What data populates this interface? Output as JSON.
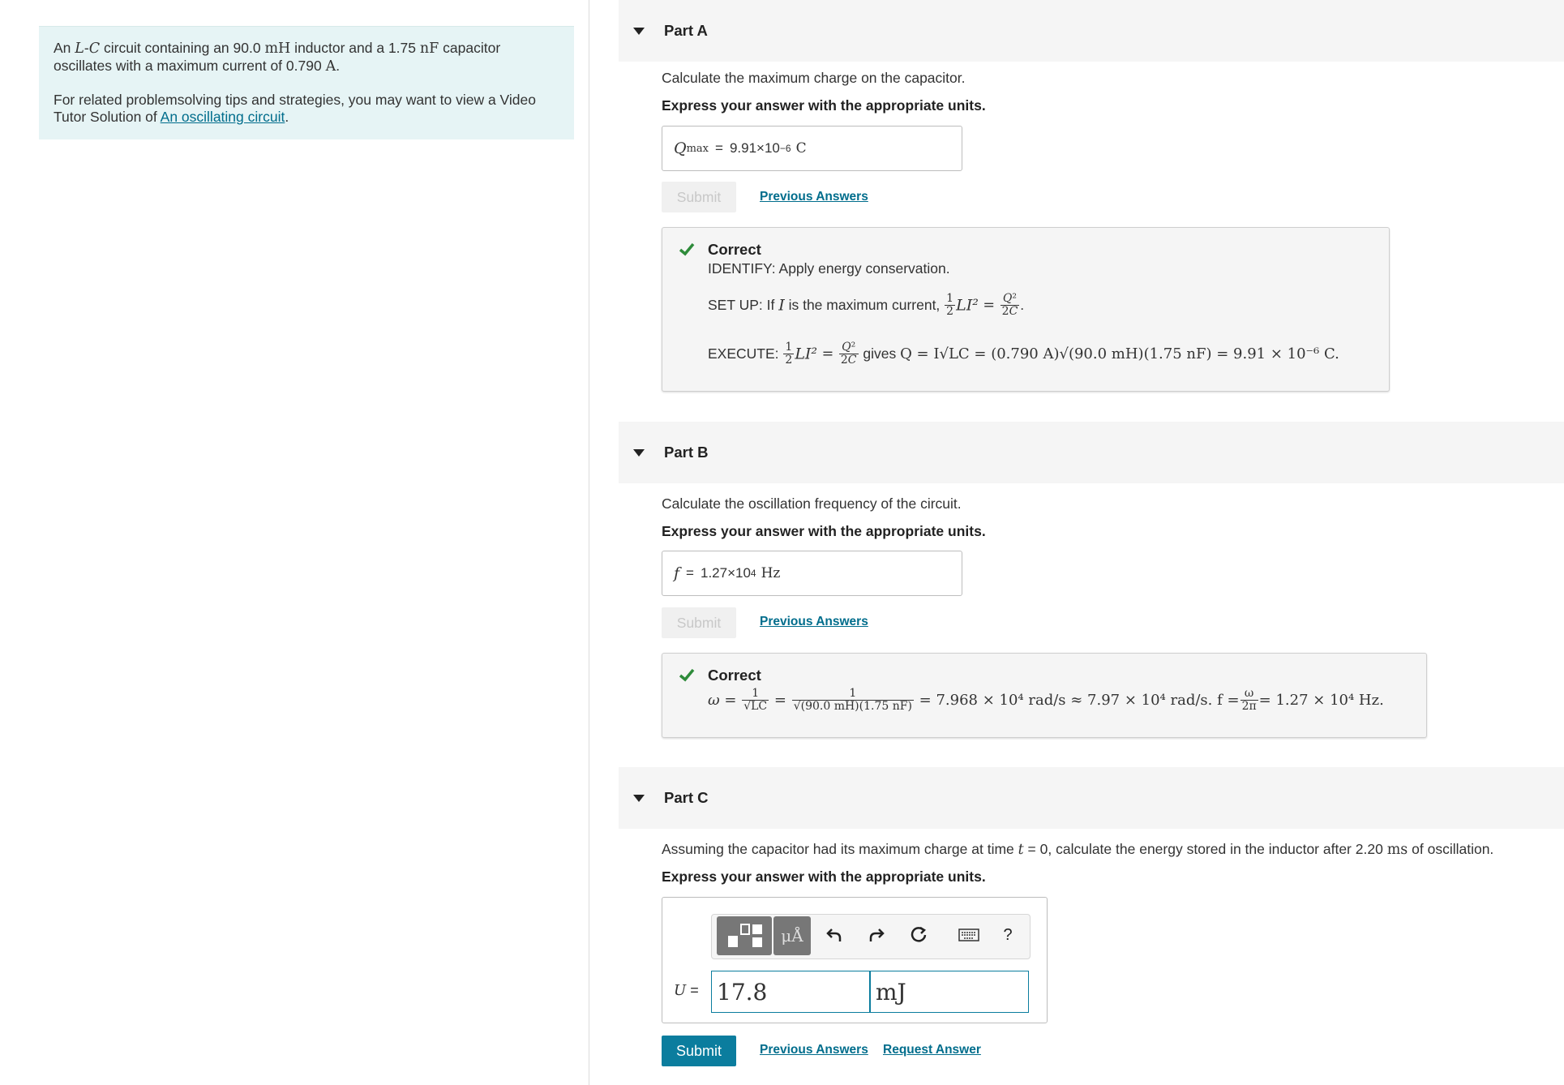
{
  "intro": {
    "p1_a": "An ",
    "p1_L": "L",
    "p1_dash": "-",
    "p1_C": "C",
    "p1_b": " circuit containing an 90.0 ",
    "p1_unit1": "mH",
    "p1_c": " inductor and a 1.75 ",
    "p1_unit2": "nF",
    "p1_d": " capacitor oscillates with a maximum current of 0.790 ",
    "p1_unit3": "A",
    "p1_e": ".",
    "p2": "For related problemsolving tips and strategies, you may want to view a Video Tutor Solution of ",
    "link": "An oscillating circuit",
    "p2_end": "."
  },
  "common": {
    "express": "Express your answer with the appropriate units.",
    "submit": "Submit",
    "previous_answers": "Previous Answers",
    "request_answer": "Request Answer",
    "correct": "Correct",
    "equals": "="
  },
  "partA": {
    "title": "Part A",
    "question": "Calculate the maximum charge on the capacitor.",
    "var": "Q",
    "var_sub": "max",
    "answer_mant": "9.91×10",
    "answer_exp": "−6",
    "answer_unit": "C",
    "identify": "IDENTIFY: Apply energy conservation.",
    "setup_text": "SET UP: If ",
    "setup_I": "I",
    "setup_text2": " is the maximum current, ",
    "execute_label": "EXECUTE: ",
    "execute_gives": " gives ",
    "execute_expr": "Q = I√LC = (0.790 A)√(90.0 mH)(1.75 nF) = 9.91 × 10⁻⁶ C."
  },
  "partB": {
    "title": "Part B",
    "question": "Calculate the oscillation frequency of the circuit.",
    "var": "f",
    "answer_mant": "1.27×10",
    "answer_exp": "4",
    "answer_unit": "Hz",
    "omega_expr": "= 7.968 × 10⁴ rad/s ≈ 7.97 × 10⁴ rad/s. f =",
    "final_expr": "= 1.27 × 10⁴ Hz.",
    "frac_num_1": "1",
    "frac_den_1": "√LC",
    "frac_den_2": "√(90.0 mH)(1.75 nF)",
    "frac_num_w": "ω",
    "frac_den_w": "2π"
  },
  "partC": {
    "title": "Part C",
    "question_a": "Assuming the capacitor had its maximum charge at time ",
    "question_t": "t",
    "question_b": " = 0, calculate the energy stored in the inductor after 2.20 ",
    "question_unit": "ms",
    "question_c": " of oscillation.",
    "var": "U",
    "value": "17.8",
    "unit": "mJ",
    "units_btn": "μÅ",
    "help": "?"
  },
  "colors": {
    "accent": "#0b7d9e",
    "check": "#2e8b3a",
    "intro_bg": "#e6f4f5"
  }
}
